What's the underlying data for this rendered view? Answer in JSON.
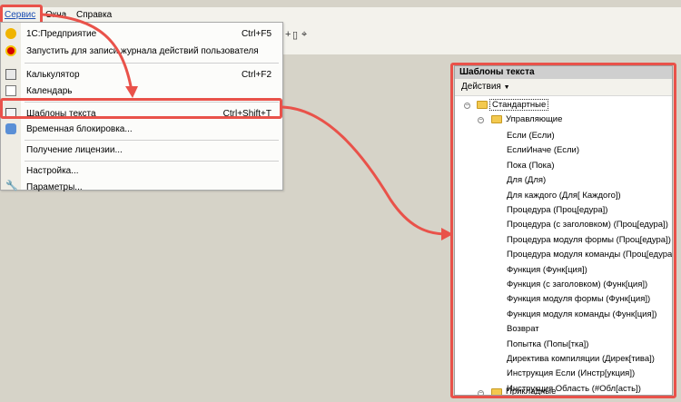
{
  "menubar": {
    "items": [
      "Сервис",
      "Окна",
      "Справка"
    ]
  },
  "service_menu": {
    "items": [
      {
        "label": "1С:Предприятие",
        "shortcut": "Ctrl+F5",
        "icon": "1c-icon"
      },
      {
        "label": "Запустить для записи журнала действий пользователя",
        "shortcut": "",
        "icon": "record-icon"
      },
      {
        "label": "Калькулятор",
        "shortcut": "Ctrl+F2",
        "icon": "calculator-icon"
      },
      {
        "label": "Календарь",
        "shortcut": "",
        "icon": "calendar-icon"
      },
      {
        "label": "Шаблоны текста",
        "shortcut": "Ctrl+Shift+T",
        "icon": "text-template-icon"
      },
      {
        "label": "Временная блокировка...",
        "shortcut": "",
        "icon": "lock-users-icon"
      },
      {
        "label": "Получение лицензии...",
        "shortcut": "",
        "icon": ""
      },
      {
        "label": "Настройка...",
        "shortcut": "",
        "icon": ""
      },
      {
        "label": "Параметры...",
        "shortcut": "",
        "icon": "wrench-icon"
      }
    ]
  },
  "templates_panel": {
    "title": "Шаблоны текста",
    "actions_label": "Действия",
    "root": "Стандартные",
    "group": "Управляющие",
    "items": [
      "Если (Если)",
      "ЕслиИначе (Если)",
      "Пока (Пока)",
      "Для (Для)",
      "Для каждого (Для[ Каждого])",
      "Процедура (Проц[едура])",
      "Процедура (с заголовком) (Проц[едура])",
      "Процедура модуля формы (Проц[едура])",
      "Процедура модуля команды (Проц[едура])",
      "Функция (Функ[ция])",
      "Функция (с заголовком) (Функ[ция])",
      "Функция модуля формы (Функ[ция])",
      "Функция модуля команды (Функ[ция])",
      "Возврат",
      "Попытка (Попы[тка])",
      "Директива компиляции (Дирек[тива])",
      "Инструкция Если (Инстр[укция])",
      "Инструкция Область (#Обл[асть])"
    ],
    "next_group": "Прикладные"
  },
  "colors": {
    "highlight": "#e9524a",
    "menu_bg": "#fcfcfa",
    "app_bg": "#d6d3c8"
  }
}
